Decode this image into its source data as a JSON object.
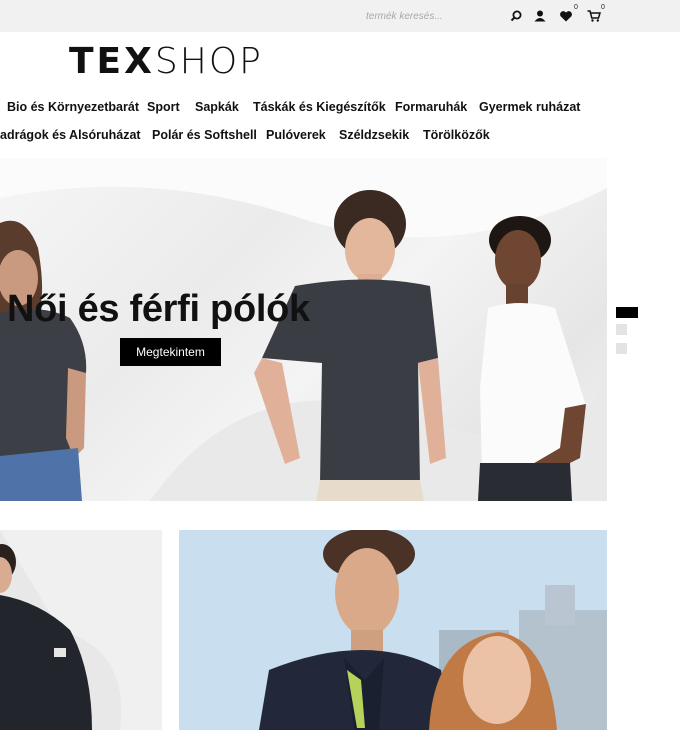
{
  "topbar": {
    "search_placeholder": "termék keresés...",
    "wishlist_count": "0",
    "cart_count": "0",
    "icons": [
      "search-icon",
      "user-icon",
      "heart-icon",
      "cart-icon"
    ]
  },
  "logo": {
    "bold": "TEX",
    "light": "SHOP"
  },
  "nav": {
    "row1": [
      "Bio és Környezetbarát",
      "Sport",
      "Sapkák",
      "Táskák és Kiegészítők",
      "Formaruhák",
      "Gyermek ruházat"
    ],
    "row2": [
      "Nadrágok és Alsóruházat",
      "Polár és Softshell",
      "Pulóverek",
      "Széldzsekik",
      "Törölközők"
    ]
  },
  "hero": {
    "title": "Női és férfi pólók",
    "button_label": "Megtekintem",
    "slides": 3,
    "active_slide": 1
  },
  "colors": {
    "topbar_bg": "#f1f1f1",
    "accent": "#000000",
    "card_sky": "#c9dff0"
  }
}
